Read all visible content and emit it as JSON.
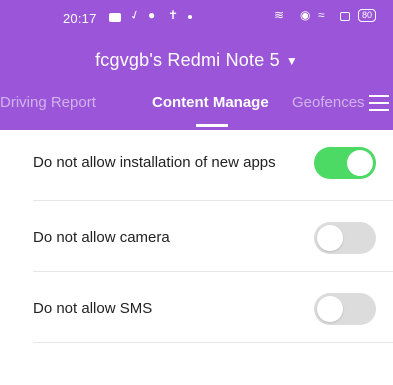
{
  "status_bar": {
    "time": "20:17",
    "battery": "80",
    "icons": [
      "message-icon",
      "check-icon",
      "person-icon",
      "person-icon",
      "dot-icon",
      "vibrate-icon",
      "location-icon",
      "wifi-icon",
      "battery-saver-icon",
      "battery-icon"
    ]
  },
  "header": {
    "device_title": "fcgvgb's Redmi Note 5",
    "dropdown_caret": "▼",
    "background": "#9a55d8"
  },
  "tabs": [
    {
      "label": "Driving Report",
      "active": false
    },
    {
      "label": "Content Manage",
      "active": true
    },
    {
      "label": "Geofences",
      "active": false
    }
  ],
  "settings": [
    {
      "label": "Do not allow installation of new apps",
      "enabled": true
    },
    {
      "label": "Do not allow camera",
      "enabled": false
    },
    {
      "label": "Do not allow SMS",
      "enabled": false
    }
  ],
  "colors": {
    "toggle_on": "#4cd964",
    "toggle_off": "#dcdcdc"
  }
}
